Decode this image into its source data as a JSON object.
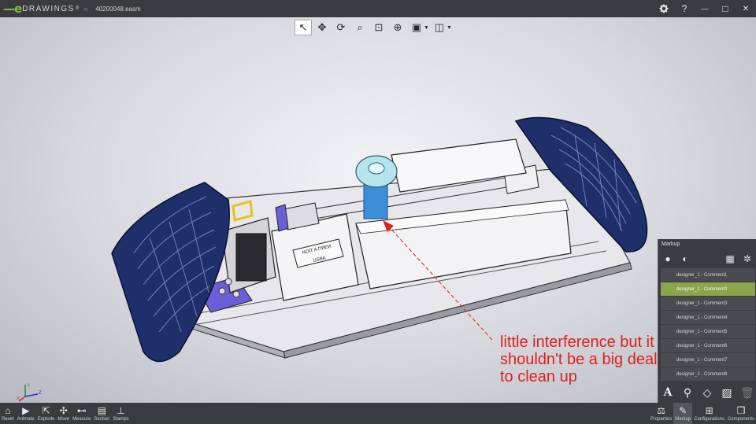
{
  "app": {
    "logo_mark": "—e",
    "logo_text": "DRAWINGS",
    "trademark": "®",
    "breadcrumb_arrow": "»",
    "file_name": "40200048.easm"
  },
  "window_controls": {
    "settings_icon": "gear-icon",
    "help": "?",
    "minimize": "—",
    "maximize": "□",
    "close": "✕"
  },
  "view_toolbar": [
    {
      "name": "select-tool",
      "glyph": "↖"
    },
    {
      "name": "pan-tool",
      "glyph": "✥"
    },
    {
      "name": "rotate-tool",
      "glyph": "⟳"
    },
    {
      "name": "zoom-tool",
      "glyph": "⌕"
    },
    {
      "name": "zoom-area-tool",
      "glyph": "⊡"
    },
    {
      "name": "zoom-fit-tool",
      "glyph": "⊕"
    },
    {
      "name": "view-orientation-tool",
      "glyph": "▣"
    },
    {
      "name": "display-style-tool",
      "glyph": "◫"
    }
  ],
  "model_labels": {
    "plate_line1": "NOIT A ПЯEИ",
    "plate_line2": "USBA"
  },
  "annotation": {
    "text": "little interference but it\nshouldn't be a big deal\nto clean up",
    "color": "#e0201a"
  },
  "triad": {
    "x": "X",
    "y": "Y",
    "z": "Z"
  },
  "markup_panel": {
    "title": "Markup",
    "comments": [
      "designer_1 - Comment1",
      "designer_1 - Comment2",
      "designer_1 - Comment3",
      "designer_1 - Comment4",
      "designer_1 - Comment5",
      "designer_1 - Comment6",
      "designer_1 - Comment7",
      "designer_1 - Comment8"
    ],
    "selected_index": 1,
    "accent": "#8aa64c"
  },
  "bottom_tools": [
    {
      "label": "Reset",
      "glyph": "⌂"
    },
    {
      "label": "Animate",
      "glyph": "▶"
    },
    {
      "label": "Explode",
      "glyph": "⇱"
    },
    {
      "label": "Move",
      "glyph": "✣"
    },
    {
      "label": "Measure",
      "glyph": "⊷"
    },
    {
      "label": "Section",
      "glyph": "▤"
    },
    {
      "label": "Stamps",
      "glyph": "⊥"
    }
  ],
  "right_tools": [
    {
      "label": "Properties",
      "glyph": "⚖"
    },
    {
      "label": "Markup",
      "glyph": "✎"
    },
    {
      "label": "Configurations",
      "glyph": "⊞"
    },
    {
      "label": "Components",
      "glyph": "❒"
    }
  ]
}
